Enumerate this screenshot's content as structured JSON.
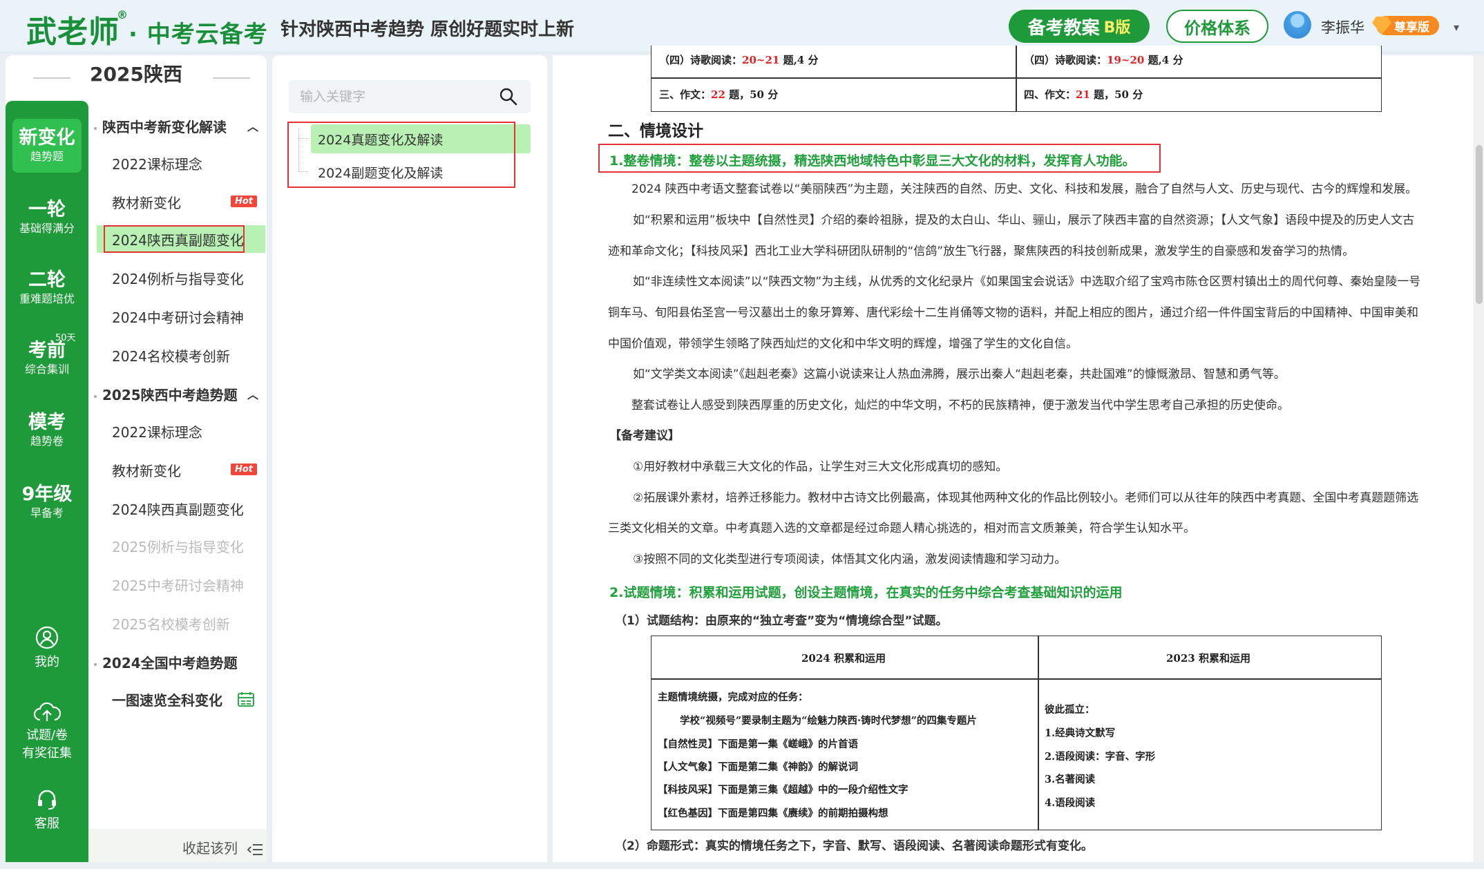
{
  "header": {
    "logo_main": "武老师",
    "logo_reg": "®",
    "logo_sub": "· 中考云备考",
    "slogan": "针对陕西中考趋势 原创好题实时上新",
    "plan_button": "备考教案",
    "plan_button_badge": "B版",
    "price_button": "价格体系",
    "user_name": "李振华",
    "vip_label": "尊享版",
    "caret": "▾"
  },
  "year_title": "2025陕西",
  "rail": [
    {
      "title": "新变化",
      "sub": "趋势题"
    },
    {
      "title": "一轮",
      "sub": "基础得满分"
    },
    {
      "title": "二轮",
      "sub": "重难题培优"
    },
    {
      "title": "考前",
      "sub": "综合集训"
    },
    {
      "title": "模考",
      "sub": "趋势卷"
    },
    {
      "title": "9年级",
      "sub": "早备考"
    }
  ],
  "rail_badge": "50天",
  "rail_bottom": {
    "me": "我的",
    "reward_line1": "试题/卷",
    "reward_line2": "有奖征集",
    "service": "客服"
  },
  "nav": {
    "group1": "陕西中考新变化解读",
    "group1_items": [
      "2022课标理念",
      "教材新变化",
      "2024陕西真副题变化",
      "2024例析与指导变化",
      "2024中考研讨会精神",
      "2024名校模考创新"
    ],
    "group2": "2025陕西中考趋势题",
    "group2_items": [
      "2022课标理念",
      "教材新变化",
      "2024陕西真副题变化",
      "2025例析与指导变化",
      "2025中考研讨会精神",
      "2025名校模考创新"
    ],
    "group3": "2024全国中考趋势题",
    "group4": "一图速览全科变化",
    "hot": "Hot",
    "collapse": "收起该列"
  },
  "search": {
    "placeholder": "输入关键字"
  },
  "tree": [
    "2024真题变化及解读",
    "2024副题变化及解读"
  ],
  "doc": {
    "top_table": {
      "r1c1_pre": "（四）诗歌阅读：",
      "r1c1_red": "20~21",
      "r1c1_post": " 题,4 分",
      "r1c2_pre": "（四）诗歌阅读：",
      "r1c2_red": "19~20",
      "r1c2_post": " 题,4 分",
      "r2c1_pre": "三、作文：",
      "r2c1_red": "22",
      "r2c1_post": " 题，50 分",
      "r2c2_pre": "四、作文：",
      "r2c2_red": "21",
      "r2c2_post": " 题，50 分"
    },
    "h2": "二、情境设计",
    "h3_1": "1.整卷情境：整卷以主题统摄，精选陕西地域特色中彰显三大文化的材料，发挥育人功能。",
    "p1": "2024 陕西中考语文整套试卷以“美丽陕西”为主题，关注陕西的自然、历史、文化、科技和发展，融合了自然与人文、历史与现代、古今的辉煌和发展。",
    "p2a": "如“积累和运用”板块中【自然性灵】介绍的秦岭祖脉，提及的太白山、华山、骊山，展示了陕西丰富的自然资源；【人文气象】语段中提及的历史人文古",
    "p2b": "迹和革命文化；【科技风采】西北工业大学科研团队研制的“信鸽”放生飞行器，聚焦陕西的科技创新成果，激发学生的自豪感和发奋学习的热情。",
    "p3a": "如“非连续性文本阅读”以“陕西文物”为主线，从优秀的文化纪录片《如果国宝会说话》中选取介绍了宝鸡市陈仓区贾村镇出土的周代何尊、秦始皇陵一号",
    "p3b": "铜车马、旬阳县佑圣宫一号汉墓出土的象牙算筹、唐代彩绘十二生肖俑等文物的语料，并配上相应的图片，通过介绍一件件国宝背后的中国精神、中国审美和",
    "p3c": "中国价值观，带领学生领略了陕西灿烂的文化和中华文明的辉煌，增强了学生的文化自信。",
    "p4": "如“文学类文本阅读”《赳赳老秦》这篇小说读来让人热血沸腾，展示出秦人“赳赳老秦，共赴国难”的慷慨激昂、智慧和勇气等。",
    "p5": "整套试卷让人感受到陕西厚重的历史文化，灿烂的中华文明，不朽的民族精神，便于激发当代中学生思考自己承担的历史使命。",
    "advice_title": "【备考建议】",
    "a1": "①用好教材中承载三大文化的作品，让学生对三大文化形成真切的感知。",
    "a2a": "②拓展课外素材，培养迁移能力。教材中古诗文比例最高，体现其他两种文化的作品比例较小。老师们可以从往年的陕西中考真题、全国中考真题题筛选",
    "a2b": "三类文化相关的文章。中考真题入选的文章都是经过命题人精心挑选的，相对而言文质兼美，符合学生认知水平。",
    "a3": "③按照不同的文化类型进行专项阅读，体悟其文化内涵，激发阅读情趣和学习动力。",
    "h3_2": "2.试题情境：积累和运用试题，创设主题情境，在真实的任务中综合考查基础知识的运用",
    "sub1": "（1）试题结构：由原来的“独立考查”变为“情境综合型”试题。",
    "table2": {
      "head1": "2024 积累和运用",
      "head2": "2023 积累和运用",
      "left_red": "主题情境统摄，完成对应的任务：",
      "left_1": "学校“视频号”要录制主题为“绘魅力陕西·铸时代梦想”的四集专题片",
      "left_2": "【自然性灵】下面是第一集《嵯峨》的片首语",
      "left_3": "【人文气象】下面是第二集《神韵》的解说词",
      "left_4": "【科技风采】下面是第三集《超越》中的一段介绍性文字",
      "left_5": "【红色基因】下面是第四集《赓续》的前期拍摄构想",
      "right_red": "彼此孤立：",
      "right_1": "1.经典诗文默写",
      "right_2": "2.语段阅读：字音、字形",
      "right_3": "3.名著阅读",
      "right_4": "4.语段阅读"
    },
    "sub2": "（2）命题形式：真实的情境任务之下，字音、默写、语段阅读、名著阅读命题形式有变化。"
  }
}
